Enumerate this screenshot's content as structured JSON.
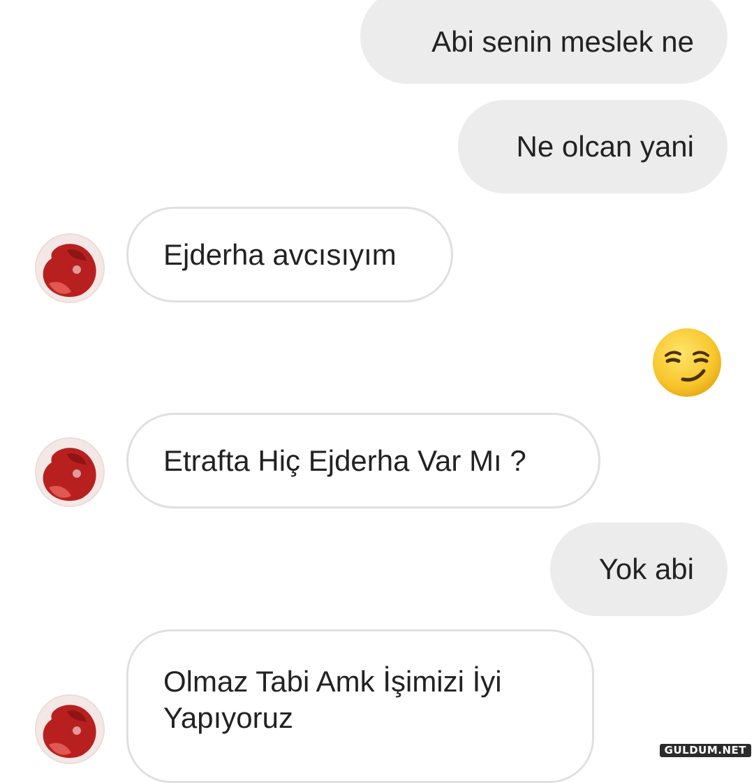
{
  "conversation": {
    "messages": [
      {
        "sender": "me",
        "text": "Abi senin meslek ne"
      },
      {
        "sender": "me",
        "text": "Ne olcan yani"
      },
      {
        "sender": "them",
        "text": "Ejderha avcısıyım"
      },
      {
        "sender": "me",
        "emoji": "smirking-face-emoji"
      },
      {
        "sender": "them",
        "text": "Etrafta Hiç Ejderha Var Mı ?"
      },
      {
        "sender": "me",
        "text": "Yok abi"
      },
      {
        "sender": "them",
        "text": "Olmaz Tabi Amk İşimizi İyi Yapıyoruz"
      }
    ]
  },
  "avatar": {
    "icon": "contact-avatar-red",
    "color": "#b8201f"
  },
  "colors": {
    "outgoing_bubble": "#ececec",
    "incoming_border": "#e0e0e0",
    "text": "#222222",
    "emoji_yellow": "#f7c52a"
  },
  "watermark": {
    "text": "GULDUM.NET"
  }
}
